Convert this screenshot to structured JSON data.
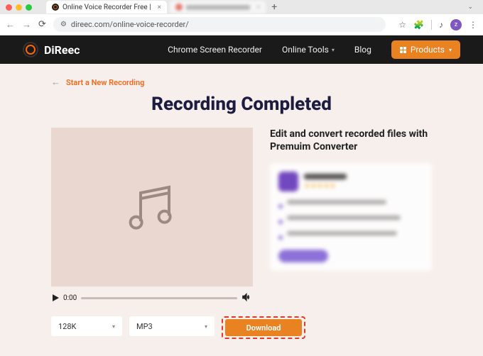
{
  "browser": {
    "tab_title": "Online Voice Recorder Free |",
    "url": "direec.com/online-voice-recorder/",
    "avatar_letter": "z"
  },
  "header": {
    "brand": "DiReec",
    "nav": {
      "screen_recorder": "Chrome Screen Recorder",
      "online_tools": "Online Tools",
      "blog": "Blog",
      "products": "Products"
    }
  },
  "page": {
    "back_label": "Start a New Recording",
    "title": "Recording Completed",
    "player_time": "0:00",
    "promo_heading": "Edit and convert recorded files with Premuim Converter"
  },
  "controls": {
    "bitrate": "128K",
    "format": "MP3",
    "download": "Download"
  }
}
